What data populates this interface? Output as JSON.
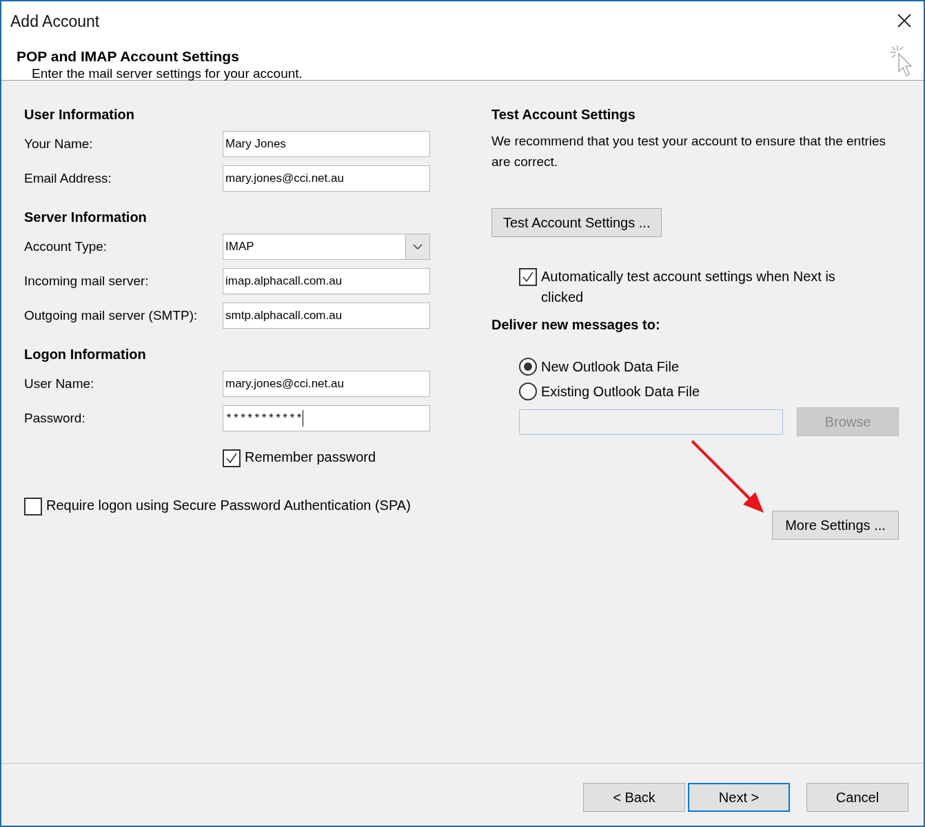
{
  "window": {
    "title": "Add Account"
  },
  "header": {
    "title": "POP and IMAP Account Settings",
    "subtitle": "Enter the mail server settings for your account."
  },
  "sections": [
    {
      "heading": "User Information",
      "fields": [
        {
          "label": "Your Name:",
          "kind": "text",
          "value": "Mary Jones"
        },
        {
          "label": "Email Address:",
          "kind": "text",
          "value": "mary.jones@cci.net.au"
        }
      ]
    },
    {
      "heading": "Server Information",
      "fields": [
        {
          "label": "Account Type:",
          "kind": "dropdown",
          "value": "IMAP"
        },
        {
          "label": "Incoming mail server:",
          "kind": "text",
          "value": "imap.alphacall.com.au"
        },
        {
          "label": "Outgoing mail server (SMTP):",
          "kind": "text",
          "value": "smtp.alphacall.com.au"
        }
      ]
    },
    {
      "heading": "Logon Information",
      "fields": [
        {
          "label": "User Name:",
          "kind": "text",
          "value": "mary.jones@cci.net.au"
        },
        {
          "label": "Password:",
          "kind": "password",
          "value": "***********"
        }
      ]
    }
  ],
  "remember_password": {
    "label": "Remember password",
    "checked": true
  },
  "require_spa": {
    "label": "Require logon using Secure Password Authentication (SPA)",
    "checked": false
  },
  "test_settings": {
    "heading": "Test Account Settings",
    "description": "We recommend that you test your account to ensure that the entries are correct.",
    "button": "Test Account Settings ...",
    "auto_test": {
      "label": "Automatically test account settings when Next is clicked",
      "checked": true
    }
  },
  "deliver": {
    "heading": "Deliver new messages to:",
    "options": [
      {
        "label": "New Outlook Data File",
        "selected": true
      },
      {
        "label": "Existing Outlook Data File",
        "selected": false
      }
    ],
    "file_field": {
      "disabled": true
    },
    "browse": {
      "label": "Browse",
      "disabled": true
    }
  },
  "more_settings": "More Settings ...",
  "footer_buttons": [
    {
      "label": "< Back",
      "default": false
    },
    {
      "label": "Next >",
      "default": true
    },
    {
      "label": "Cancel",
      "default": false
    }
  ]
}
